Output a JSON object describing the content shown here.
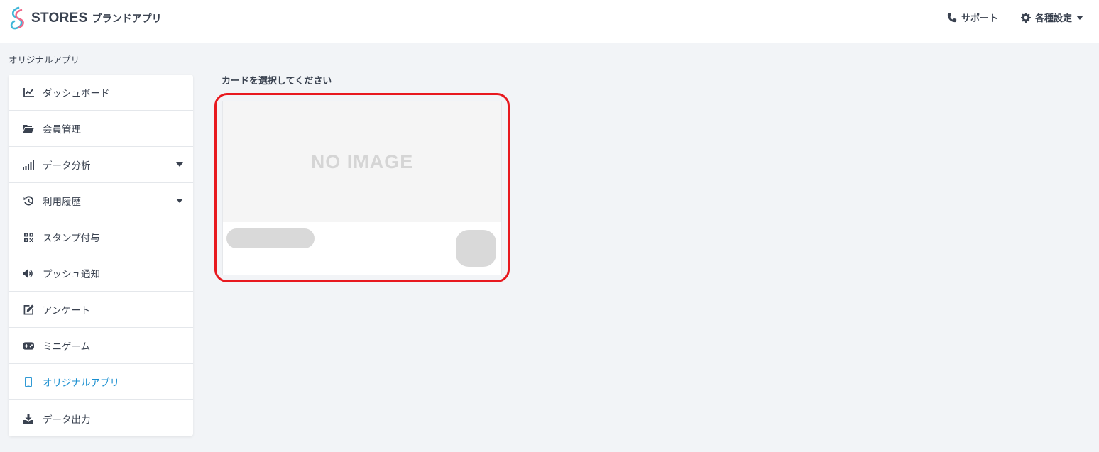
{
  "header": {
    "brand_word": "STORES",
    "brand_sub": "ブランドアプリ",
    "support_label": "サポート",
    "settings_label": "各種設定"
  },
  "breadcrumb": "オリジナルアプリ",
  "sidebar": {
    "items": [
      {
        "label": "ダッシュボード",
        "icon": "chart-line-icon"
      },
      {
        "label": "会員管理",
        "icon": "folder-open-icon"
      },
      {
        "label": "データ分析",
        "icon": "signal-bars-icon",
        "has_dropdown": true
      },
      {
        "label": "利用履歴",
        "icon": "history-icon",
        "has_dropdown": true
      },
      {
        "label": "スタンプ付与",
        "icon": "qrcode-icon"
      },
      {
        "label": "プッシュ通知",
        "icon": "volume-icon"
      },
      {
        "label": "アンケート",
        "icon": "edit-icon"
      },
      {
        "label": "ミニゲーム",
        "icon": "gamepad-icon"
      },
      {
        "label": "オリジナルアプリ",
        "icon": "mobile-icon",
        "active": true
      },
      {
        "label": "データ出力",
        "icon": "download-icon"
      }
    ]
  },
  "main": {
    "section_title": "カードを選択してください",
    "card": {
      "placeholder_text": "NO IMAGE"
    }
  },
  "colors": {
    "accent": "#1a8fd0",
    "highlight": "#e8191f",
    "text": "#3a4250",
    "background": "#f2f4f7"
  }
}
